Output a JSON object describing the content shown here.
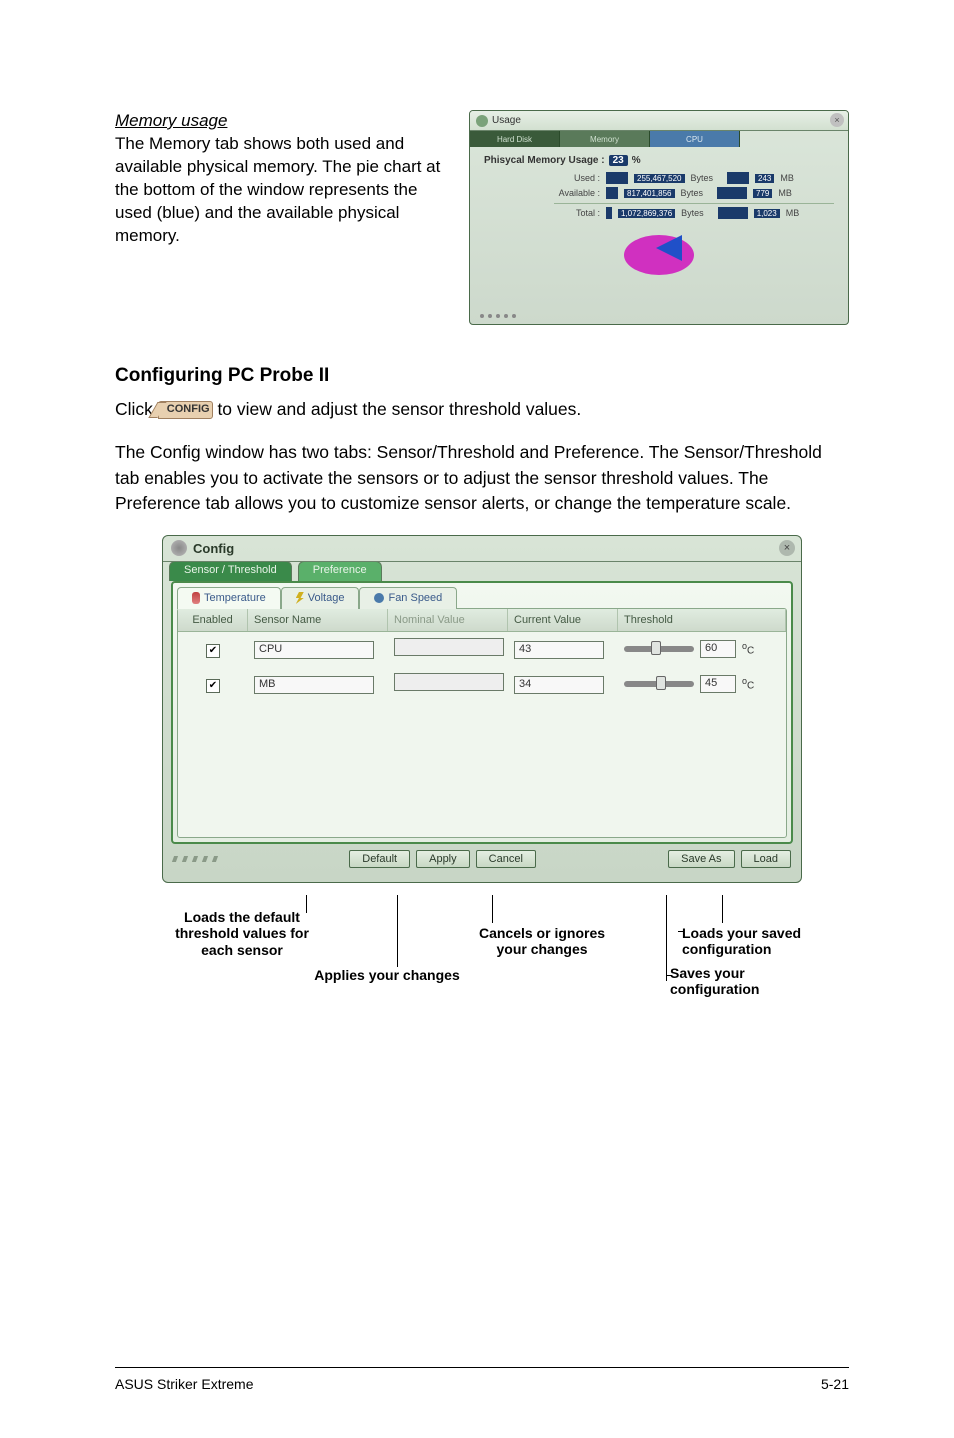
{
  "memory": {
    "heading": "Memory usage",
    "body": "The Memory tab shows both used and available physical memory. The pie chart at the bottom of the window represents the used (blue) and the available physical memory."
  },
  "usage_window": {
    "title": "Usage",
    "tabs": {
      "left": "Hard Disk",
      "mid": "Memory",
      "right": "CPU"
    },
    "pmu_label": "Phisycal Memory Usage :",
    "pmu_pct": "23",
    "pmu_pct_suffix": "%",
    "rows": {
      "used": {
        "label": "Used :",
        "bytes": "255,467,520",
        "unit_b": "Bytes",
        "mb": "243",
        "unit_m": "MB"
      },
      "avail": {
        "label": "Available :",
        "bytes": "817,401,856",
        "unit_b": "Bytes",
        "mb": "779",
        "unit_m": "MB"
      },
      "total": {
        "label": "Total :",
        "bytes": "1,072,869,376",
        "unit_b": "Bytes",
        "mb": "1,023",
        "unit_m": "MB"
      }
    }
  },
  "configuring": {
    "heading": "Configuring PC Probe II",
    "click_prefix": "Click ",
    "config_btn": "CONFIG",
    "click_suffix": " to view and adjust the sensor threshold values.",
    "para2": "The Config window has two tabs: Sensor/Threshold and Preference. The Sensor/Threshold tab enables you to activate the sensors or to adjust the sensor threshold values. The Preference tab allows you to customize sensor alerts, or change the temperature scale."
  },
  "config_window": {
    "title": "Config",
    "tabs_top": {
      "active": "Sensor / Threshold",
      "inactive": "Preference"
    },
    "subtabs": {
      "temp": "Temperature",
      "volt": "Voltage",
      "fan": "Fan Speed"
    },
    "columns": {
      "enabled": "Enabled",
      "sensor": "Sensor Name",
      "nominal": "Nominal Value",
      "current": "Current Value",
      "threshold": "Threshold"
    },
    "rows": [
      {
        "checked": true,
        "name": "CPU",
        "nominal": "",
        "current": "43",
        "threshold": "60",
        "unit_pre": "o",
        "unit": "C",
        "thumb_pct": 38
      },
      {
        "checked": true,
        "name": "MB",
        "nominal": "",
        "current": "34",
        "threshold": "45",
        "unit_pre": "o",
        "unit": "C",
        "thumb_pct": 46
      }
    ],
    "buttons": {
      "def": "Default",
      "apply": "Apply",
      "cancel": "Cancel",
      "saveas": "Save As",
      "load": "Load"
    }
  },
  "annotations": {
    "default": "Loads the default threshold values for each sensor",
    "apply": "Applies your changes",
    "cancel": "Cancels or ignores your changes",
    "saveas": "Saves your configuration",
    "load": "Loads your saved configuration"
  },
  "footer": {
    "left": "ASUS Striker Extreme",
    "right": "5-21"
  }
}
